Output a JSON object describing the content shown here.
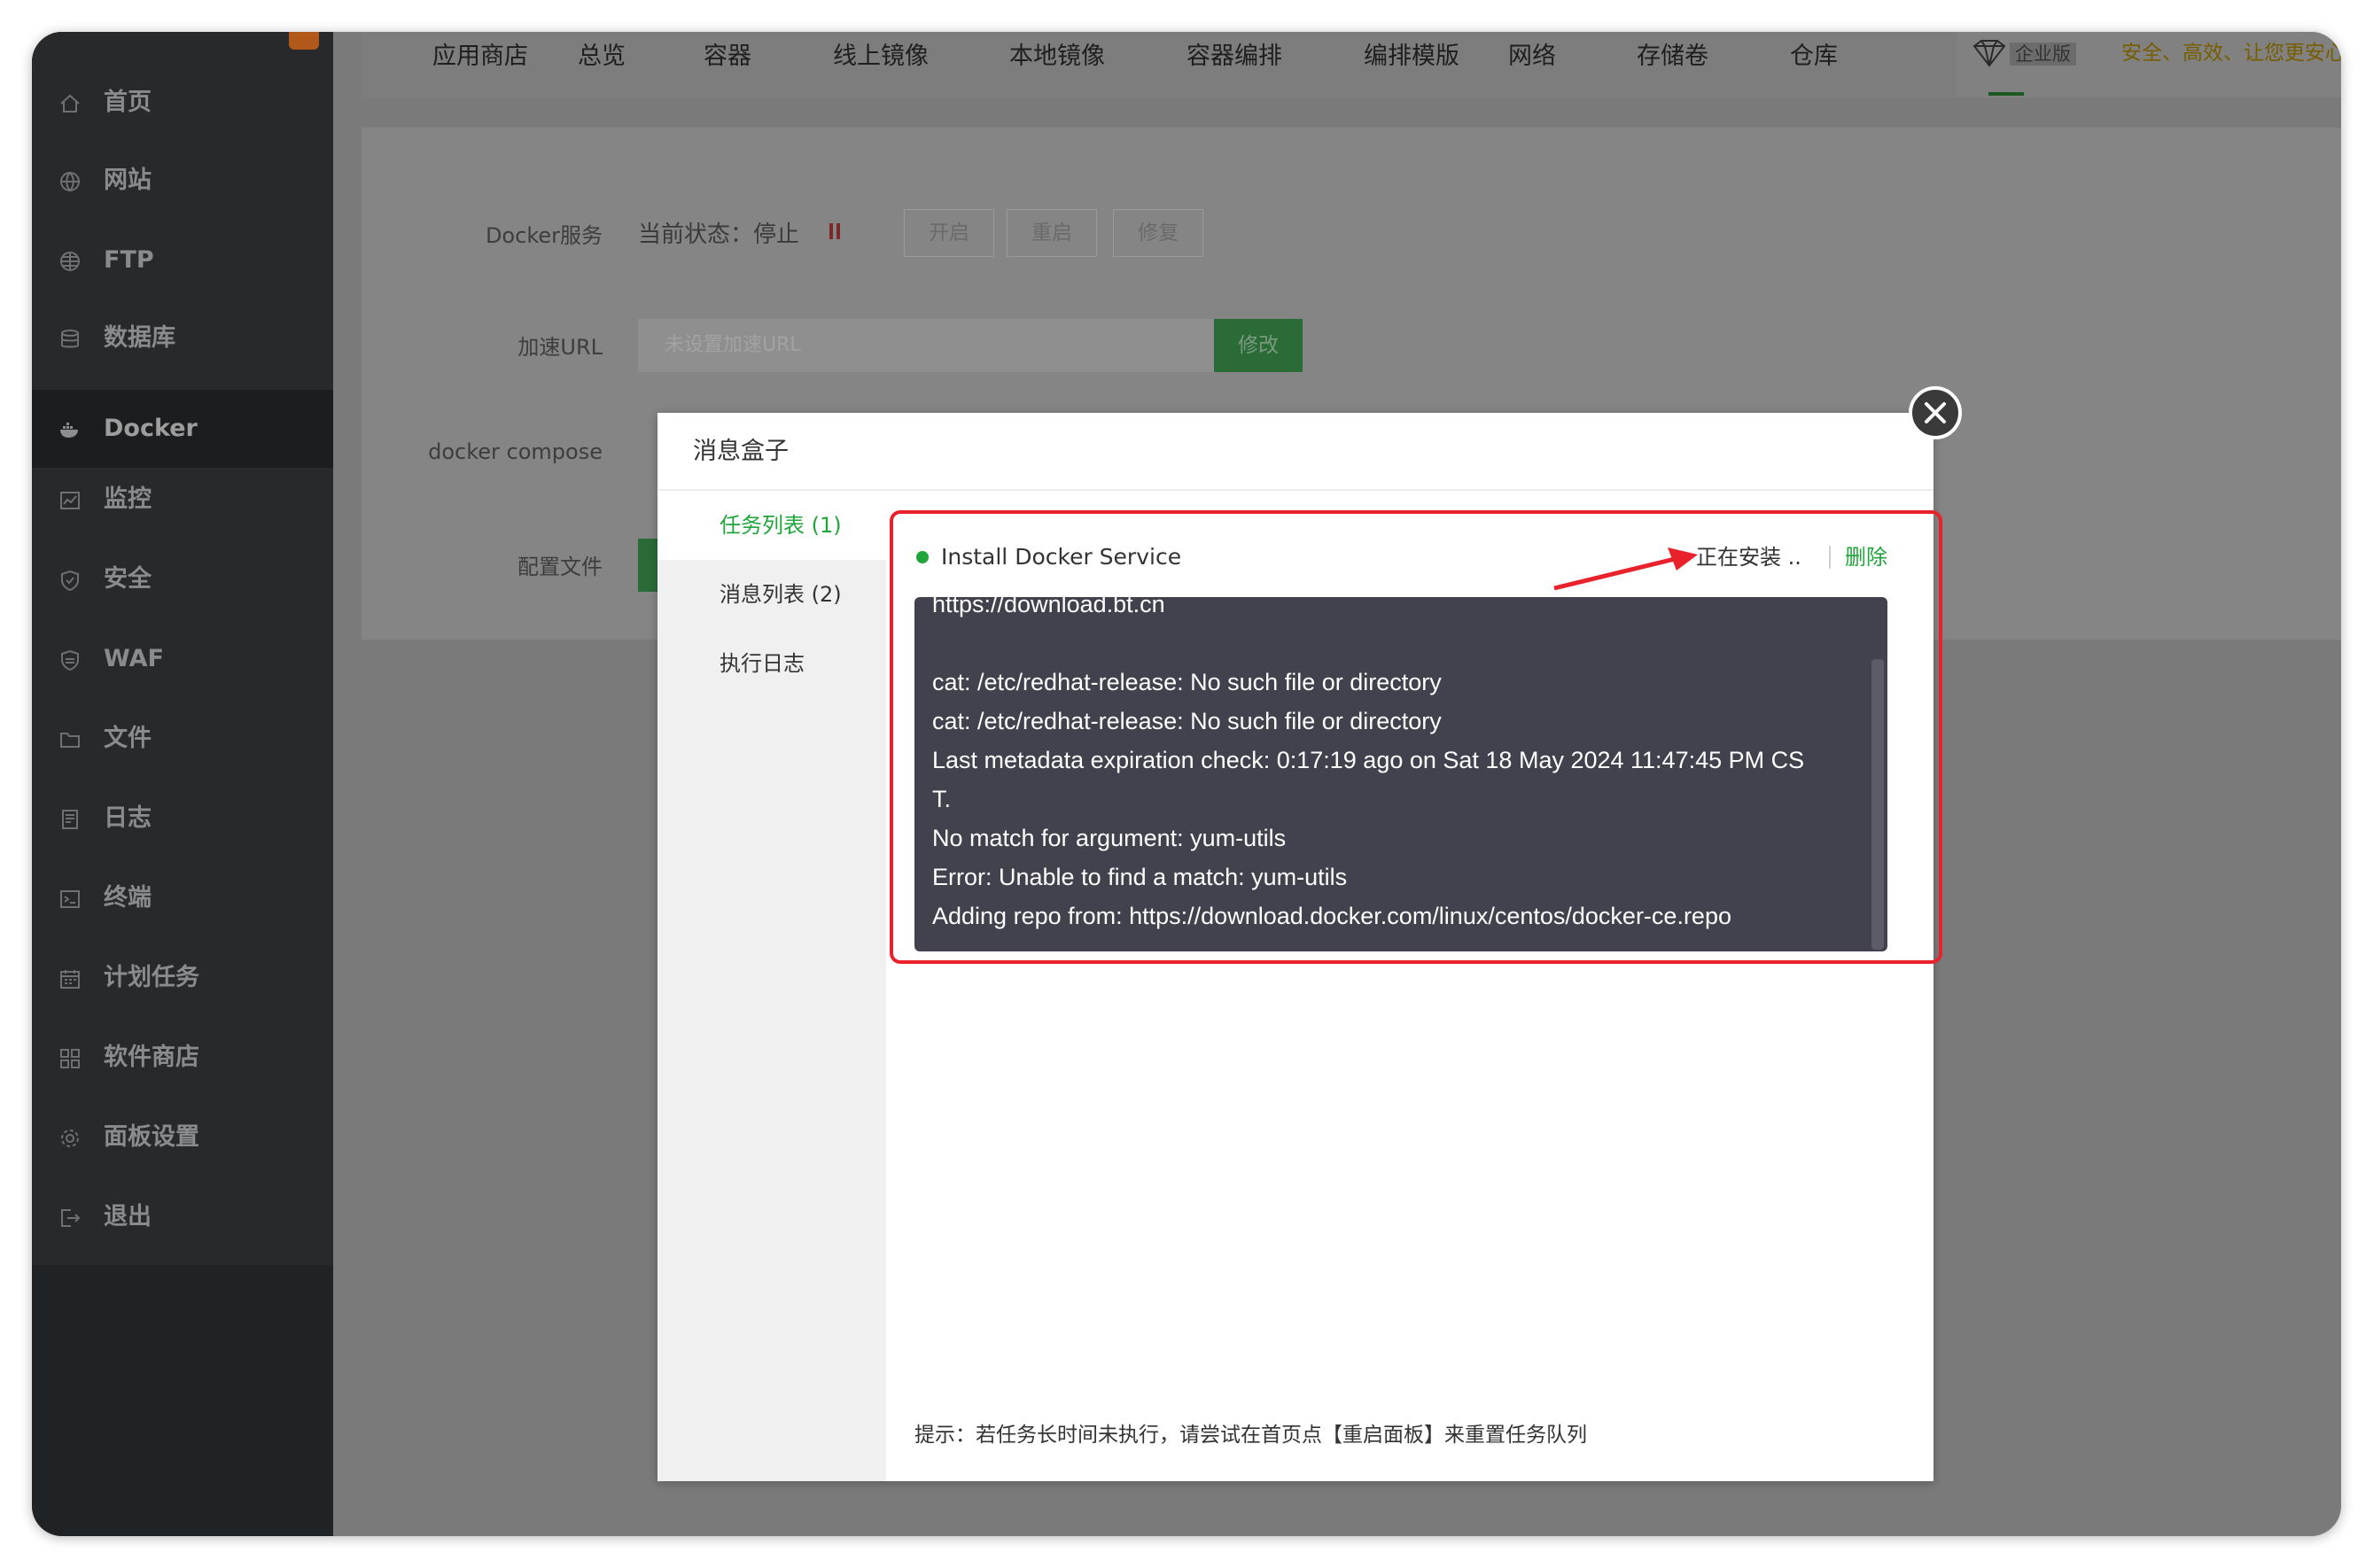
{
  "sidebar": {
    "items": [
      {
        "label": "首页",
        "icon": "home-icon"
      },
      {
        "label": "网站",
        "icon": "globe-icon"
      },
      {
        "label": "FTP",
        "icon": "ftp-globe-icon"
      },
      {
        "label": "数据库",
        "icon": "database-icon"
      },
      {
        "label": "Docker",
        "icon": "docker-whale-icon",
        "active": true
      },
      {
        "label": "监控",
        "icon": "monitor-icon"
      },
      {
        "label": "安全",
        "icon": "shield-icon"
      },
      {
        "label": "WAF",
        "icon": "waf-shield-icon"
      },
      {
        "label": "文件",
        "icon": "folder-icon"
      },
      {
        "label": "日志",
        "icon": "log-icon"
      },
      {
        "label": "终端",
        "icon": "terminal-icon"
      },
      {
        "label": "计划任务",
        "icon": "calendar-icon"
      },
      {
        "label": "软件商店",
        "icon": "apps-grid-icon"
      },
      {
        "label": "面板设置",
        "icon": "gear-icon"
      },
      {
        "label": "退出",
        "icon": "logout-icon"
      }
    ]
  },
  "topbar": {
    "tabs": [
      "应用商店",
      "总览",
      "容器",
      "线上镜像",
      "本地镜像",
      "容器编排",
      "编排模版",
      "网络",
      "存储卷",
      "仓库"
    ],
    "enterprise": {
      "tag": "企业版",
      "slogan": "安全、高效、让您更安心",
      "icon": "diamond-icon"
    }
  },
  "page": {
    "docker_service_label": "Docker服务",
    "status_text": "当前状态：停止",
    "start_btn": "开启",
    "restart_btn": "重启",
    "repair_btn": "修复",
    "mirror_label": "加速URL",
    "mirror_placeholder": "未设置加速URL",
    "modify_btn": "修改",
    "compose_label": "docker compose",
    "config_label": "配置文件"
  },
  "modal": {
    "title": "消息盒子",
    "side_tabs": [
      "任务列表 (1)",
      "消息列表 (2)",
      "执行日志"
    ],
    "task": {
      "name": "Install Docker Service",
      "status": "正在安装 ..",
      "delete": "删除"
    },
    "log_lines": [
      "https://download.bt.cn",
      "",
      "cat: /etc/redhat-release: No such file or directory",
      "cat: /etc/redhat-release: No such file or directory",
      "Last metadata expiration check: 0:17:19 ago on Sat 18 May 2024 11:47:45 PM CS",
      "T.",
      "No match for argument: yum-utils",
      "Error: Unable to find a match: yum-utils",
      "Adding repo from: https://download.docker.com/linux/centos/docker-ce.repo"
    ],
    "tip": "提示：若任务长时间未执行，请尝试在首页点【重启面板】来重置任务队列"
  },
  "colors": {
    "accent_green": "#20a53a",
    "highlight_red": "#e8212b",
    "sidebar_bg": "#28292b",
    "log_bg": "#42424f"
  }
}
